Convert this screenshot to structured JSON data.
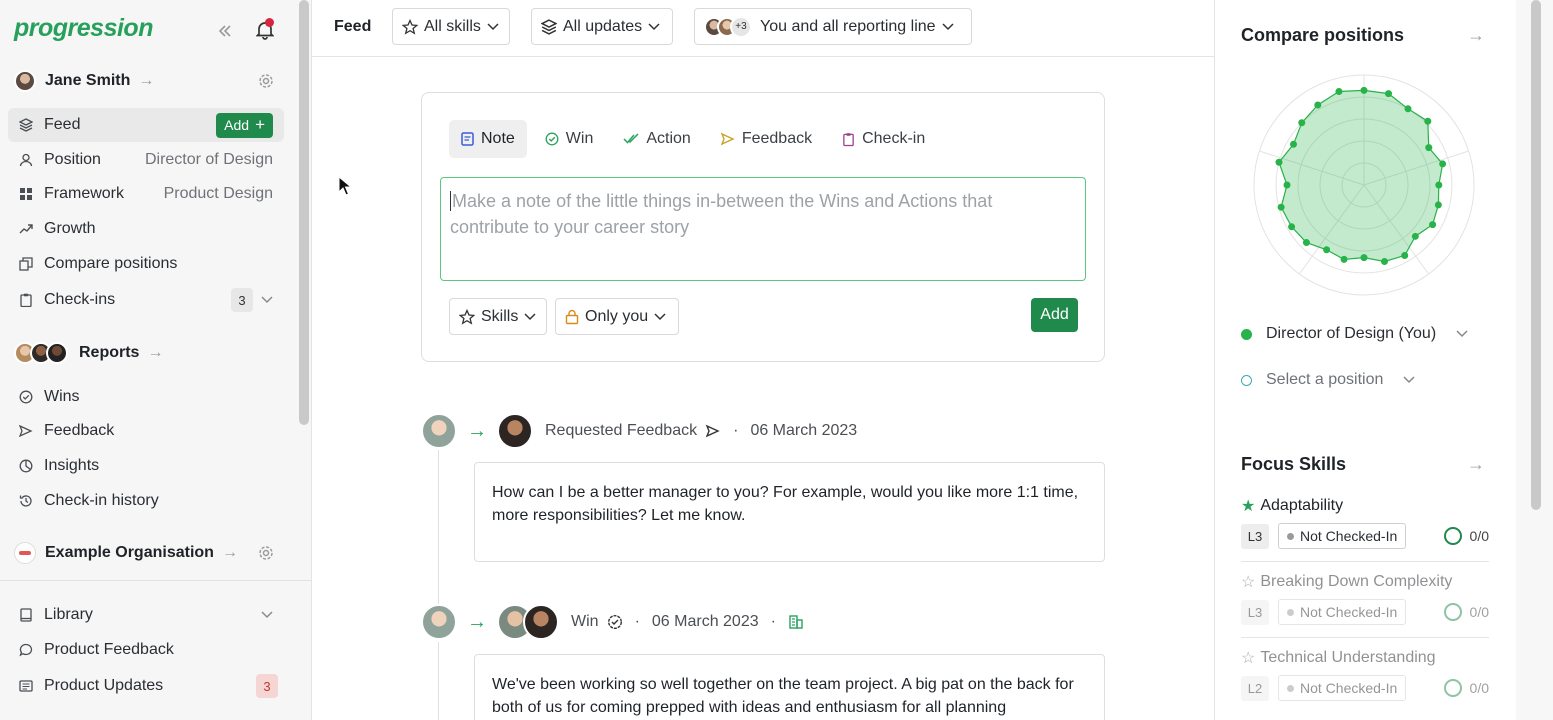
{
  "sidebar": {
    "logo": "progression",
    "user": {
      "name": "Jane Smith"
    },
    "nav": [
      {
        "label": "Feed",
        "add_label": "Add"
      },
      {
        "label": "Position",
        "value": "Director of Design"
      },
      {
        "label": "Framework",
        "value": "Product Design"
      },
      {
        "label": "Growth"
      },
      {
        "label": "Compare positions"
      },
      {
        "label": "Check-ins",
        "count": "3"
      }
    ],
    "reports": {
      "title": "Reports",
      "items": [
        {
          "label": "Wins"
        },
        {
          "label": "Feedback"
        },
        {
          "label": "Insights"
        },
        {
          "label": "Check-in history"
        }
      ]
    },
    "organisation": {
      "name": "Example Organisation"
    },
    "bottom": [
      {
        "label": "Library"
      },
      {
        "label": "Product Feedback"
      },
      {
        "label": "Product Updates",
        "count": "3"
      }
    ]
  },
  "topbar": {
    "title": "Feed",
    "skills_filter": "All skills",
    "updates_filter": "All updates",
    "people_more": "+3",
    "people_filter": "You and all reporting line"
  },
  "composer": {
    "tabs": [
      {
        "label": "Note",
        "icon": "note-icon",
        "color": "#3b5bdb"
      },
      {
        "label": "Win",
        "icon": "check-circle-icon",
        "color": "#27a35d"
      },
      {
        "label": "Action",
        "icon": "double-check-icon",
        "color": "#27a35d"
      },
      {
        "label": "Feedback",
        "icon": "megaphone-icon",
        "color": "#c9a227"
      },
      {
        "label": "Check-in",
        "icon": "clipboard-icon",
        "color": "#9b3f8f"
      }
    ],
    "placeholder": "Make a note of the little things in-between the Wins and Actions that contribute to your career story",
    "skills_btn": "Skills",
    "visibility_btn": "Only you",
    "add_btn": "Add"
  },
  "feed": [
    {
      "type": "Requested Feedback",
      "date": "06 March 2023",
      "body": "How can I be a better manager to you? For example, would you like more 1:1 time, more responsibilities? Let me know."
    },
    {
      "type": "Win",
      "date": "06 March 2023",
      "body": "We've been working so well together on the team project. A big pat on the back for both of us for coming prepped with ideas and enthusiasm for all planning"
    }
  ],
  "compare": {
    "title": "Compare positions",
    "primary_position": "Director of Design (You)",
    "primary_color": "#27b24a",
    "secondary_placeholder": "Select a position",
    "secondary_color": "#3fa7b5"
  },
  "focus": {
    "title": "Focus Skills",
    "skills": [
      {
        "name": "Adaptability",
        "level": "L3",
        "status": "Not Checked-In",
        "score": "0/0",
        "starred": true
      },
      {
        "name": "Breaking Down Complexity",
        "level": "L3",
        "status": "Not Checked-In",
        "score": "0/0",
        "starred": false
      },
      {
        "name": "Technical Understanding",
        "level": "L2",
        "status": "Not Checked-In",
        "score": "0/0",
        "starred": false
      }
    ]
  }
}
